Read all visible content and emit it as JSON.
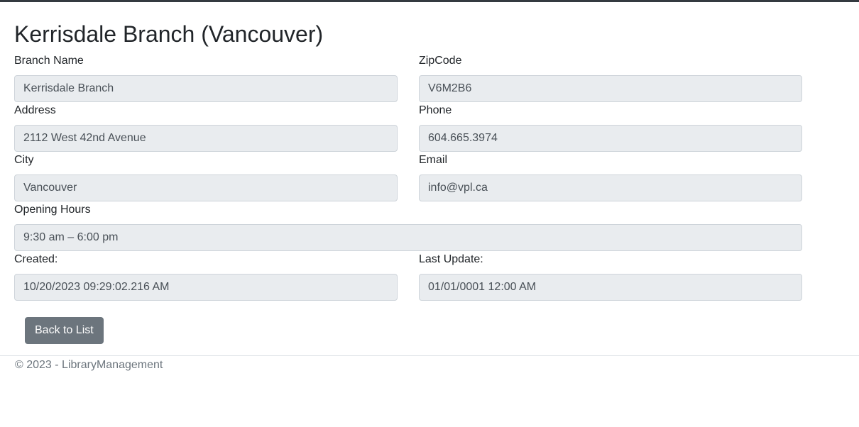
{
  "page": {
    "title": "Kerrisdale Branch (Vancouver)"
  },
  "fields": {
    "branch_name": {
      "label": "Branch Name",
      "value": "Kerrisdale Branch"
    },
    "zip_code": {
      "label": "ZipCode",
      "value": "V6M2B6"
    },
    "address": {
      "label": "Address",
      "value": "2112 West 42nd Avenue"
    },
    "phone": {
      "label": "Phone",
      "value": "604.665.3974"
    },
    "city": {
      "label": "City",
      "value": "Vancouver"
    },
    "email": {
      "label": "Email",
      "value": "info@vpl.ca"
    },
    "opening_hours": {
      "label": "Opening Hours",
      "value": "9:30 am – 6:00 pm"
    },
    "created": {
      "label": "Created:",
      "value": "10/20/2023 09:29:02.216  AM"
    },
    "last_update": {
      "label": "Last Update:",
      "value": "01/01/0001 12:00  AM"
    }
  },
  "actions": {
    "back_label": "Back to List"
  },
  "footer": {
    "text": "© 2023 - LibraryManagement"
  },
  "colors": {
    "top_bar": "#343a40",
    "input_bg": "#e9ecef",
    "button_bg": "#6c757d"
  }
}
